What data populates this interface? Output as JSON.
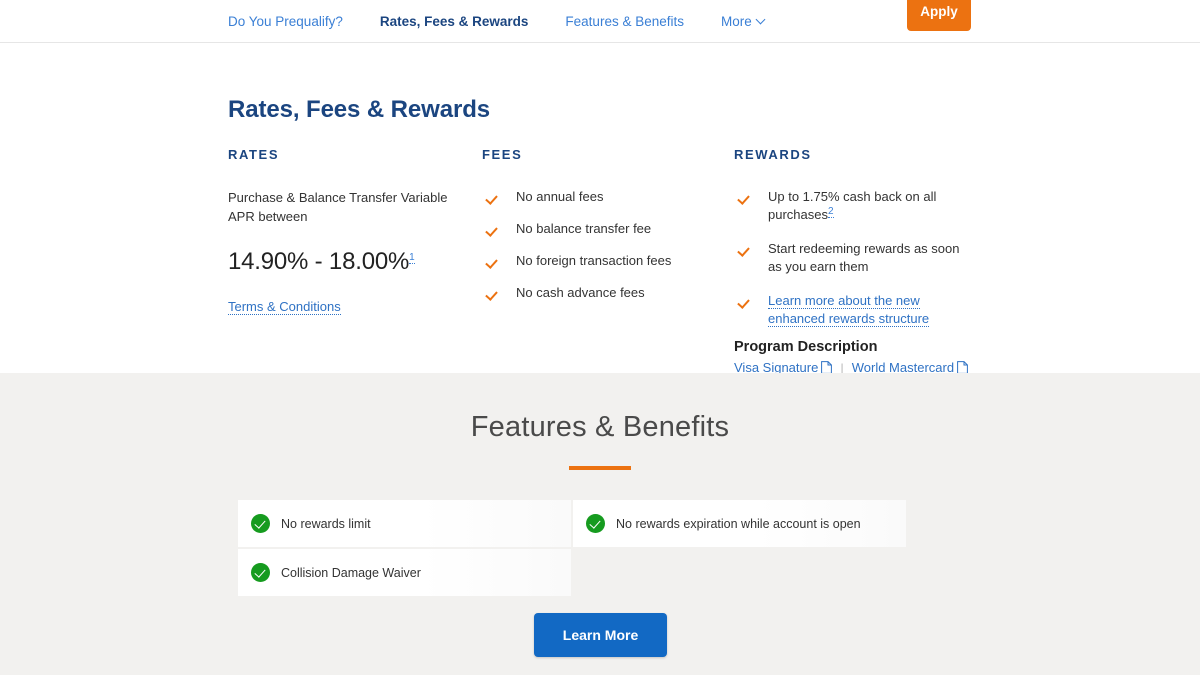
{
  "nav": {
    "links": [
      {
        "label": "Do You Prequalify?",
        "active": false,
        "has_chevron": false
      },
      {
        "label": "Rates, Fees & Rewards",
        "active": true,
        "has_chevron": false
      },
      {
        "label": "Features & Benefits",
        "active": false,
        "has_chevron": false
      },
      {
        "label": "More",
        "active": false,
        "has_chevron": true
      }
    ],
    "apply_label": "Apply",
    "link_color": "#3a7fd5",
    "active_color": "#1b4580",
    "apply_color": "#ec7211"
  },
  "rates_section": {
    "title": "Rates, Fees & Rewards",
    "title_color": "#1b4580",
    "rates": {
      "heading": "RATES",
      "description": "Purchase & Balance Transfer Variable APR between",
      "apr": "14.90% - 18.00%",
      "apr_footnote": "1",
      "terms_link": "Terms & Conditions"
    },
    "fees": {
      "heading": "FEES",
      "items": [
        "No annual fees",
        "No balance transfer fee",
        "No foreign transaction fees",
        "No cash advance fees"
      ],
      "check_color": "#ec7211"
    },
    "rewards": {
      "heading": "REWARDS",
      "items": [
        {
          "text": "Up to 1.75% cash back on all purchases",
          "footnote": "2",
          "is_link": false
        },
        {
          "text": "Start redeeming rewards as soon as you earn them",
          "footnote": "",
          "is_link": false
        },
        {
          "text": "Learn more about the new enhanced rewards structure",
          "footnote": "",
          "is_link": true
        }
      ]
    },
    "program_description": {
      "title": "Program Description",
      "links": [
        {
          "label": "Visa Signature",
          "icon": "document-icon"
        },
        {
          "label": "World Mastercard",
          "icon": "document-icon"
        }
      ],
      "separator": "|"
    }
  },
  "features_section": {
    "title": "Features & Benefits",
    "accent_color": "#ec7211",
    "background": "#f2f1ef",
    "tiles": [
      {
        "label": "No rewards limit",
        "filled": true
      },
      {
        "label": "No rewards expiration while account is open",
        "filled": true
      },
      {
        "label": "Collision Damage Waiver",
        "filled": true
      },
      {
        "label": "",
        "filled": false
      }
    ],
    "check_color": "#169b1f",
    "learn_more_label": "Learn More",
    "learn_more_color": "#1269c4"
  }
}
